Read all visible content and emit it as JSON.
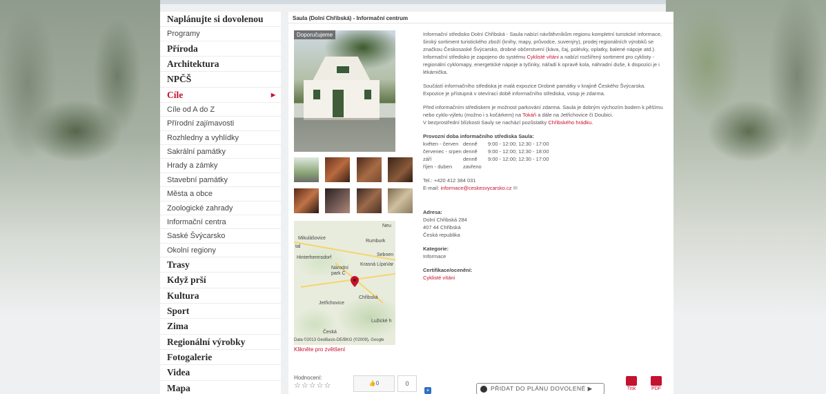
{
  "sidebar": {
    "items": [
      {
        "label": "Naplánujte si dovolenou",
        "type": "main"
      },
      {
        "label": "Programy",
        "type": "sub"
      },
      {
        "label": "Příroda",
        "type": "main"
      },
      {
        "label": "Architektura",
        "type": "main"
      },
      {
        "label": "NPČŠ",
        "type": "main"
      },
      {
        "label": "Cíle",
        "type": "main",
        "active": true
      },
      {
        "label": "Cíle od A do Z",
        "type": "sub"
      },
      {
        "label": "Přírodní zajímavosti",
        "type": "sub"
      },
      {
        "label": "Rozhledny a vyhlídky",
        "type": "sub"
      },
      {
        "label": "Sakrální památky",
        "type": "sub"
      },
      {
        "label": "Hrady a zámky",
        "type": "sub"
      },
      {
        "label": "Stavební památky",
        "type": "sub"
      },
      {
        "label": "Města a obce",
        "type": "sub"
      },
      {
        "label": "Zoologické zahrady",
        "type": "sub"
      },
      {
        "label": "Informační centra",
        "type": "sub"
      },
      {
        "label": "Saské Švýcarsko",
        "type": "sub"
      },
      {
        "label": "Okolní regiony",
        "type": "sub"
      },
      {
        "label": "Trasy",
        "type": "main"
      },
      {
        "label": "Když prší",
        "type": "main"
      },
      {
        "label": "Kultura",
        "type": "main"
      },
      {
        "label": "Sport",
        "type": "main"
      },
      {
        "label": "Zima",
        "type": "main"
      },
      {
        "label": "Regionální výrobky",
        "type": "main"
      },
      {
        "label": "Fotogalerie",
        "type": "main"
      },
      {
        "label": "Videa",
        "type": "main"
      },
      {
        "label": "Mapa",
        "type": "main"
      }
    ]
  },
  "content": {
    "title": "Saula (Dolní Chřibská) - Informační centrum",
    "recommended_badge": "Doporučujeme",
    "map_caption": "Klikněte pro zvětšení",
    "map_labels": {
      "l1": "Neu",
      "l2": "Mikulášovice",
      "l3": "Rumburk",
      "l4": "tal",
      "l5": "Hinterhermsdorf",
      "l6": "Sebnen",
      "l7": "Národní",
      "l8": "park Č",
      "l9": "Krasná Lípa",
      "l10": "Var",
      "l11": "Chřibská",
      "l12": "Jetřichovice",
      "l13": "Lužické h",
      "l14": "Česká",
      "l15": "Data ©2013 GeoBasis-DE/BKG (©2009), Google"
    },
    "paragraphs": {
      "p1a": "Informační středisko Dolní Chřibská - Saula nabízí návštěvníkům regionu kompletní turistické informace, široký sortiment turistického zboží (knihy, mapy, průvodce, suvenýry), prodej regionálních výrobků se značkou Českosaské Švýcarsko, drobné občerstvení (káva, čaj, polévky, oplatky, balené nápoje atd.). Informační středisko je zapojeno do systému ",
      "p1_link": "Cyklisté vítáni",
      "p1b": " a nabízí rozšířený sortiment pro cyklisty - regionální cyklomapy, energetické nápoje a tyčinky, nářadí k opravě kola, náhradní duše, k dispozici je i lékárnička.",
      "p2a": "Součástí informačního střediska je malá expozice Drobné památky v krajině Českého Švýcarska.",
      "p2b": "Expozice je přístupná v otevírací době informačního střediska, vstup je zdarma.",
      "p3a": "Před informačním střediskem je možnost parkování zdarma. Saula je dobrým výchozím bodem k pěšímu nebo cyklo-výletu (možno i s kočárkem) na ",
      "p3_link1": "Tokáň",
      "p3b": " a dále na Jetřichovice či Doubici.",
      "p3c": "V bezprostřední blízkosti Sauly se nachází pozůstatky ",
      "p3_link2": "Chřibského hrádku",
      "p3d": "."
    },
    "hours": {
      "title": "Provozní doba informačního střediska Saula:",
      "rows": [
        {
          "months": "květen - červen",
          "days": "denně",
          "time": "9:00 - 12:00; 12:30 - 17:00"
        },
        {
          "months": "červenec - srpen",
          "days": "denně",
          "time": "9:00 - 12:00; 12:30 - 18:00"
        },
        {
          "months": "září",
          "days": "denně",
          "time": "9:00 - 12:00; 12:30 - 17:00"
        },
        {
          "months": "říjen - duben",
          "days": "zavřeno",
          "time": ""
        }
      ]
    },
    "contact": {
      "tel": "Tel.: +420 412 384 031",
      "email_label": "E-mail:",
      "email": "informace@ceskesvycarsko.cz"
    },
    "address": {
      "label": "Adresa:",
      "line1": "Dolní Chřibská 284",
      "line2": "407 44 Chřibská",
      "line3": "Česká republika"
    },
    "category": {
      "label": "Kategorie:",
      "value": "Informace"
    },
    "certification": {
      "label": "Certifikace/ocenění:",
      "value": "Cyklisté vítáni"
    },
    "rating": {
      "label": "Hodnocení:",
      "stars": "☆☆☆☆☆"
    },
    "like": {
      "label": "👍0",
      "count": "0"
    },
    "share_icon": "+",
    "plan_button": "PŘIDAT DO PLÁNU DOVOLENÉ ▶",
    "print": {
      "tisk": "Tisk",
      "pdf": "PDF"
    }
  },
  "colors": {
    "accent": "#c4122f"
  }
}
